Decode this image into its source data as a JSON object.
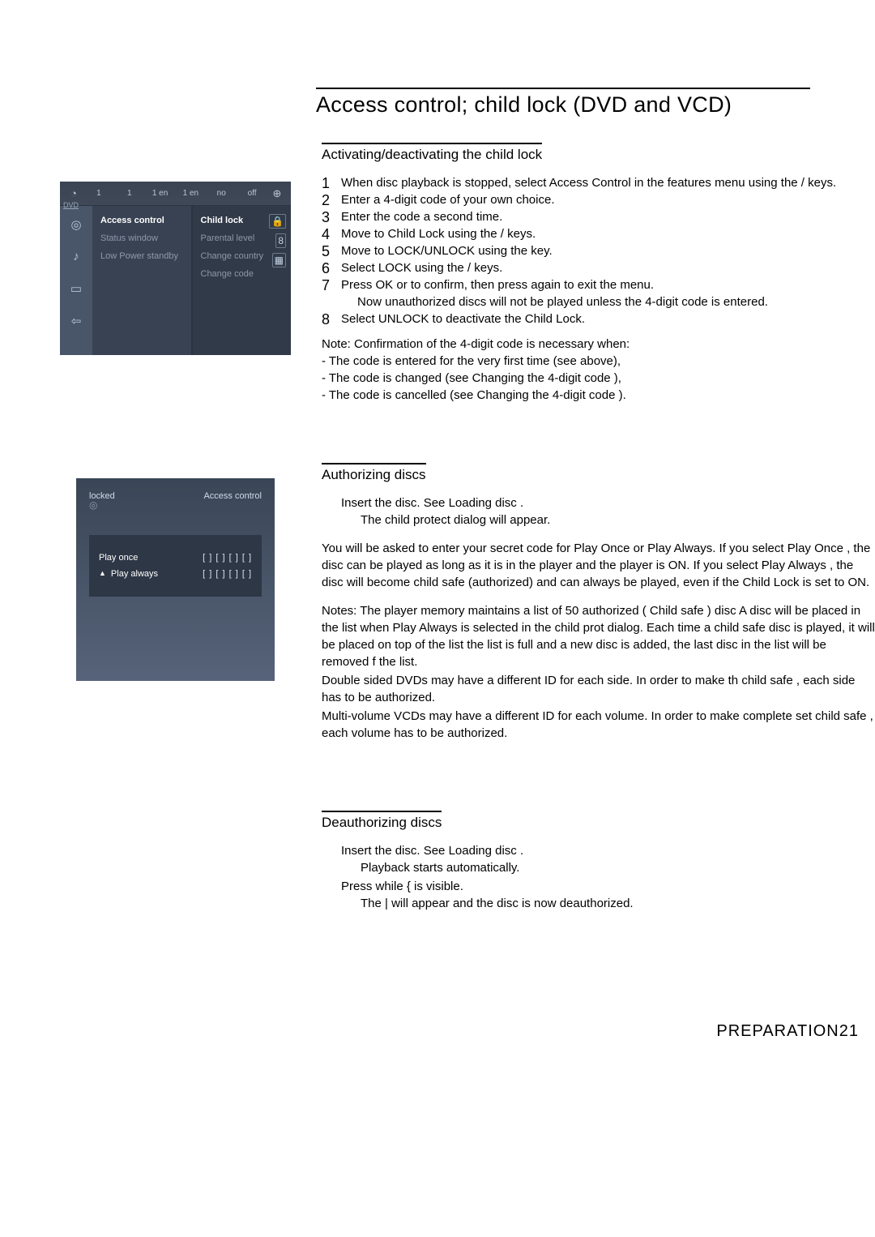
{
  "page_title": "Access control; child lock (DVD and VCD)",
  "sections": {
    "activating": {
      "heading": "Activating/deactivating the child lock",
      "steps": [
        {
          "n": "1",
          "text": "When disc playback is stopped, select Access Control in the features menu using the /   keys."
        },
        {
          "n": "2",
          "text": "Enter a 4-digit code of your own choice."
        },
        {
          "n": "3",
          "text": "Enter the code a second time."
        },
        {
          "n": "4",
          "text": "Move to  Child Lock  using the  /   keys."
        },
        {
          "n": "5",
          "text": "Move to LOCK/UNLOCK using the  key."
        },
        {
          "n": "6",
          "text": "Select LOCK using the /   keys."
        },
        {
          "n": "7",
          "text": "Press OK or   to confirm, then press   again to exit the menu.",
          "sub": "Now unauthorized discs will not be played unless the 4-digit code is entered."
        },
        {
          "n": "8",
          "text": "Select UNLOCK to deactivate the Child Lock."
        }
      ],
      "note_title": "Note: Confirmation of the 4-digit code is necessary when:",
      "note_lines": [
        "- The code is entered for the very first time (see above),",
        "- The code is changed (see  Changing the 4-digit code ),",
        "- The code is cancelled (see  Changing the 4-digit code )."
      ]
    },
    "authorizing": {
      "heading": "Authorizing discs",
      "line1": "Insert the disc. See  Loading disc .",
      "line1b": "The  child protect  dialog will appear.",
      "para1": "You will be asked to enter your secret code for  Play Once  or  Play Always.  If you select  Play Once , the disc can be played as long as it is in the player and the player is ON. If you select  Play Always , the disc will become child safe (authorized) and can always be played, even if the Child Lock is set to ON.",
      "para2": "Notes: The player memory maintains a list of 50 authorized ( Child safe ) disc A disc will be placed in the list when  Play Always  is selected in the  child prot dialog. Each time a  child safe  disc is played, it will be placed on top of the list the list is full and a new disc is added, the last disc in the list will be removed f the list.",
      "para3": "Double sided DVDs may have a different ID for each side. In order to make th  child safe , each side has to be authorized.",
      "para4": "Multi-volume VCDs may have a different ID for each volume. In order to make complete set  child safe , each volume has to be authorized."
    },
    "deauthorizing": {
      "heading": "Deauthorizing discs",
      "line1": "Insert the disc. See  Loading disc .",
      "line1b": "Playback starts automatically.",
      "line2": "Press    while {    is visible.",
      "line2b": "The |    will appear and the disc is now deauthorized."
    }
  },
  "footer": {
    "label": "PREPARATION",
    "page": "21"
  },
  "osd1": {
    "topbar": {
      "dvd": "DVD",
      "c1": "1",
      "c2": "1",
      "c3": "1 en",
      "c4": "1 en",
      "c5": "no",
      "c6": "off"
    },
    "left": [
      "Access control",
      "Status window",
      "Low Power standby"
    ],
    "right": [
      "Child lock",
      "Parental level",
      "Change country",
      "Change code"
    ]
  },
  "osd2": {
    "locked": "locked",
    "access": "Access control",
    "play_once": "Play once",
    "play_always": "Play always",
    "boxes": "[ ] [ ] [ ] [ ]"
  }
}
